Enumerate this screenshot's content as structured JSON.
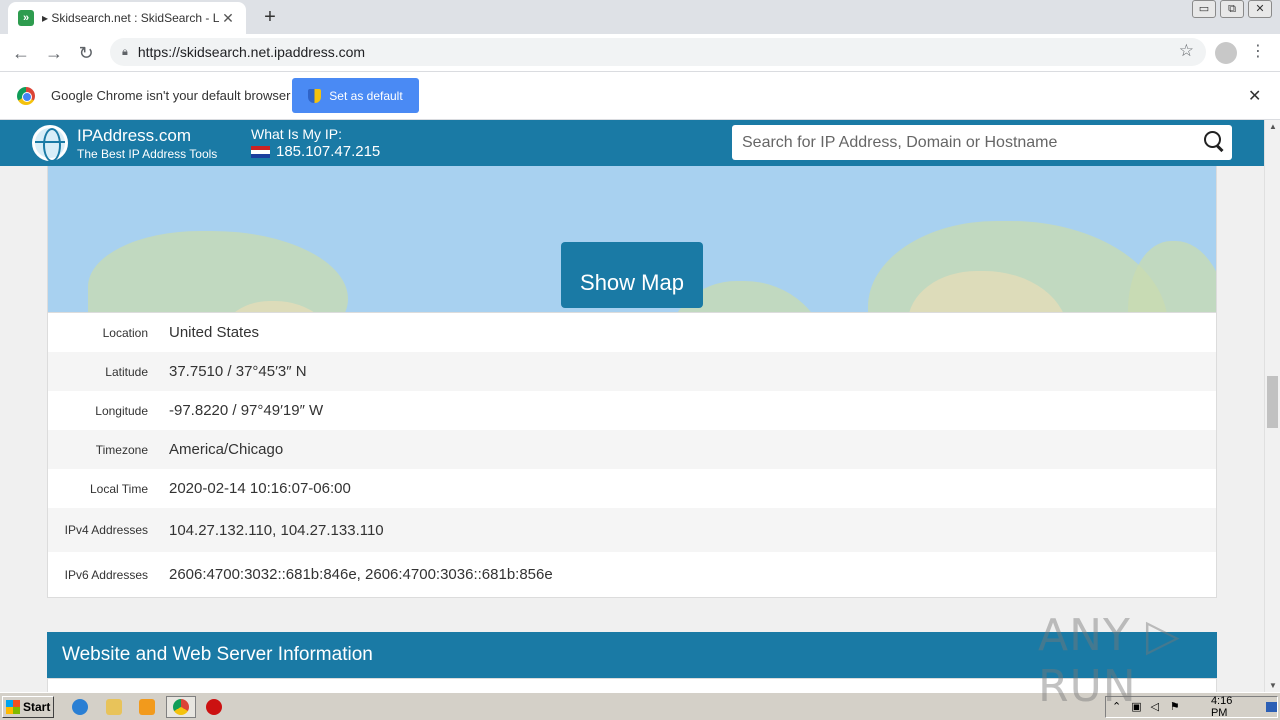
{
  "browser": {
    "tab_title": "▸ Skidsearch.net : SkidSearch - Login",
    "tab_close": "✕",
    "new_tab": "+",
    "url": "https://skidsearch.net.ipaddress.com",
    "window_controls": [
      "▭",
      "⧉",
      "✕"
    ]
  },
  "infobar": {
    "message": "Google Chrome isn't your default browser",
    "set_default_label": "Set as default",
    "close": "✕"
  },
  "site": {
    "brand_name": "IPAddress.com",
    "brand_tagline": "The Best IP Address Tools",
    "my_ip_label": "What Is My IP:",
    "my_ip_value": "185.107.47.215",
    "search_placeholder": "Search for IP Address, Domain or Hostname"
  },
  "map": {
    "show_map_label": "Show Map"
  },
  "details": [
    {
      "key": "Location",
      "value": "United States"
    },
    {
      "key": "Latitude",
      "value": "37.7510 / 37°45′3″ N"
    },
    {
      "key": "Longitude",
      "value": "-97.8220 / 97°49′19″ W"
    },
    {
      "key": "Timezone",
      "value": "America/Chicago"
    },
    {
      "key": "Local Time",
      "value": "2020-02-14 10:16:07-06:00"
    },
    {
      "key": "IPv4 Addresses",
      "value": "104.27.132.110, 104.27.133.110"
    },
    {
      "key": "IPv6 Addresses",
      "value": "2606:4700:3032::681b:846e, 2606:4700:3036::681b:856e"
    }
  ],
  "website_section": {
    "title": "Website and Web Server Information"
  },
  "watermark": "ANY ▷ RUN",
  "taskbar": {
    "start_label": "Start",
    "clock": "4:16 PM"
  },
  "colors": {
    "site_primary": "#1a7aa5",
    "chrome_button": "#4a8af4"
  }
}
